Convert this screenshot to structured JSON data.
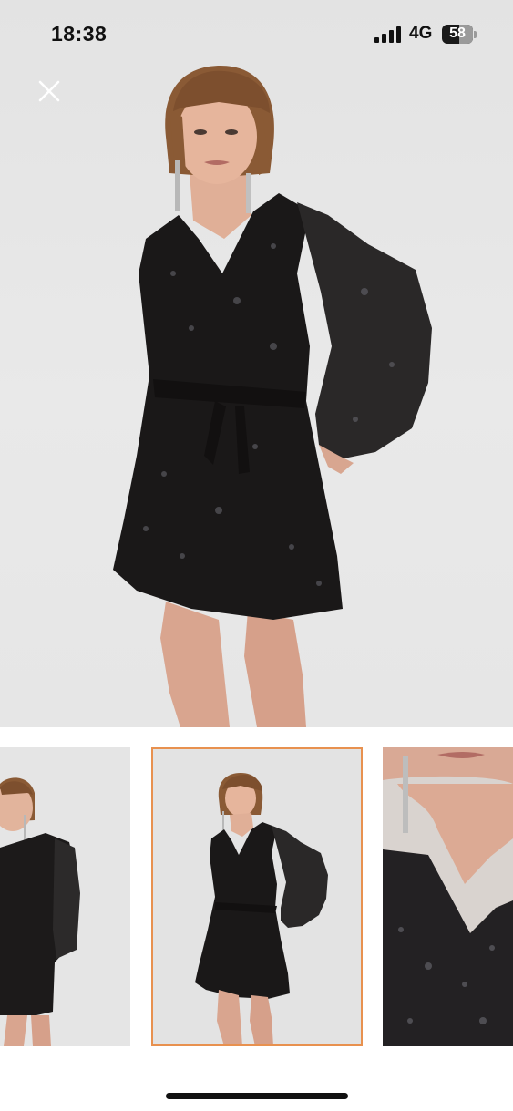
{
  "status_bar": {
    "time": "18:38",
    "network": "4G",
    "battery_level": "58",
    "battery_fraction": 0.58
  },
  "viewer": {
    "close_icon": "close-icon",
    "hero_image": "model-black-sequin-dress-front",
    "selected_thumbnail_index": 1,
    "selected_border_color": "#e8914f"
  },
  "thumbnails": [
    {
      "name": "thumbnail-side-view"
    },
    {
      "name": "thumbnail-front-view"
    },
    {
      "name": "thumbnail-neckline-closeup"
    }
  ]
}
